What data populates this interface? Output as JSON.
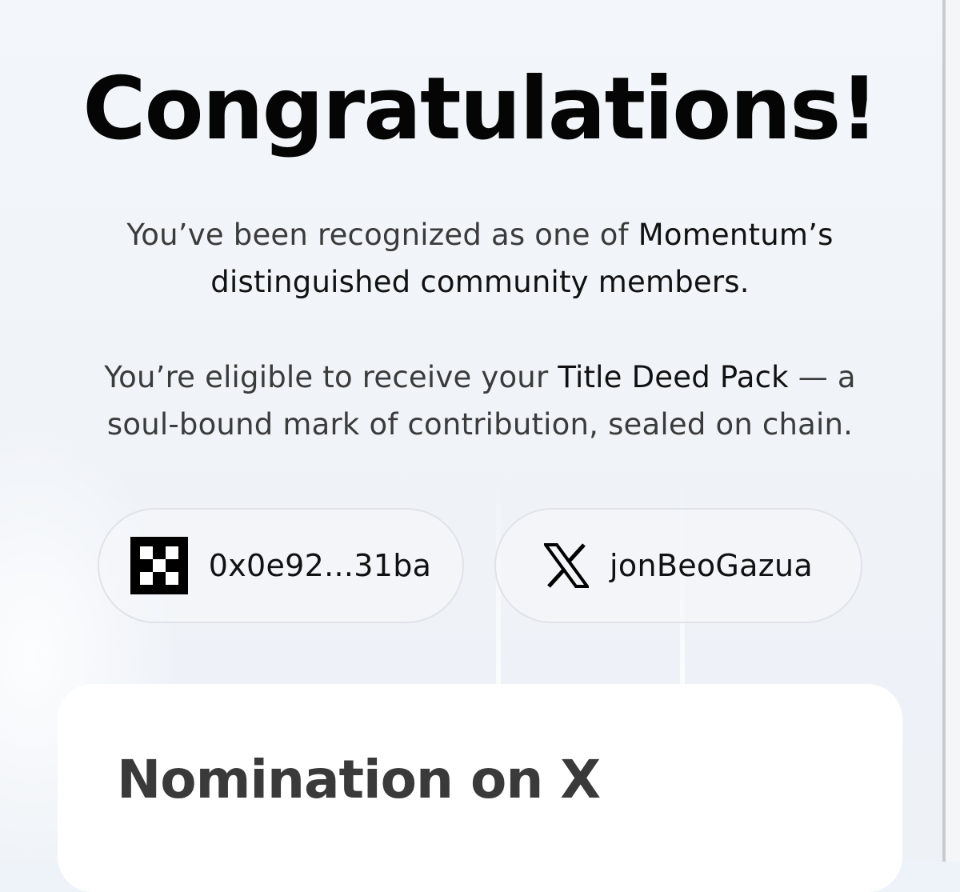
{
  "header": {
    "title": "Congratulations!"
  },
  "intro": {
    "line1_prefix": "You’ve been recognized as one of ",
    "line1_bold": "Momentum’s",
    "line2_bold": "distinguished community members."
  },
  "eligibility": {
    "line1_prefix": "You’re eligible to receive your ",
    "line1_bold": "Title Deed Pack",
    "line1_suffix": " — a",
    "line2": "soul-bound mark of contribution, sealed on chain."
  },
  "accounts": {
    "wallet": {
      "icon": "okx-icon",
      "label": "0x0e92...31ba"
    },
    "x": {
      "icon": "x-icon",
      "label": "jonBeoGazua"
    }
  },
  "nomination_card": {
    "title": "Nomination on X"
  },
  "colors": {
    "background": "#eef3f9",
    "card": "#ffffff",
    "title_text": "#050505",
    "body_text": "#3b3b3b",
    "pill_border": "#dfe3e9"
  }
}
